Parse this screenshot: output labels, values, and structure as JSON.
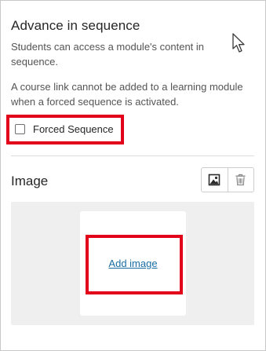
{
  "sequence": {
    "title": "Advance in sequence",
    "description": "Students can access a module's content in sequence.",
    "warning": "A course link cannot be added to a learning module when a forced sequence is activated.",
    "forced_checkbox": {
      "label": "Forced Sequence",
      "checked": false
    }
  },
  "image": {
    "title": "Image",
    "add_link": "Add image",
    "buttons": {
      "replace_icon": "image-icon",
      "delete_icon": "trash-icon"
    }
  },
  "colors": {
    "highlight": "#e2001a",
    "link": "#1b6ea5"
  }
}
